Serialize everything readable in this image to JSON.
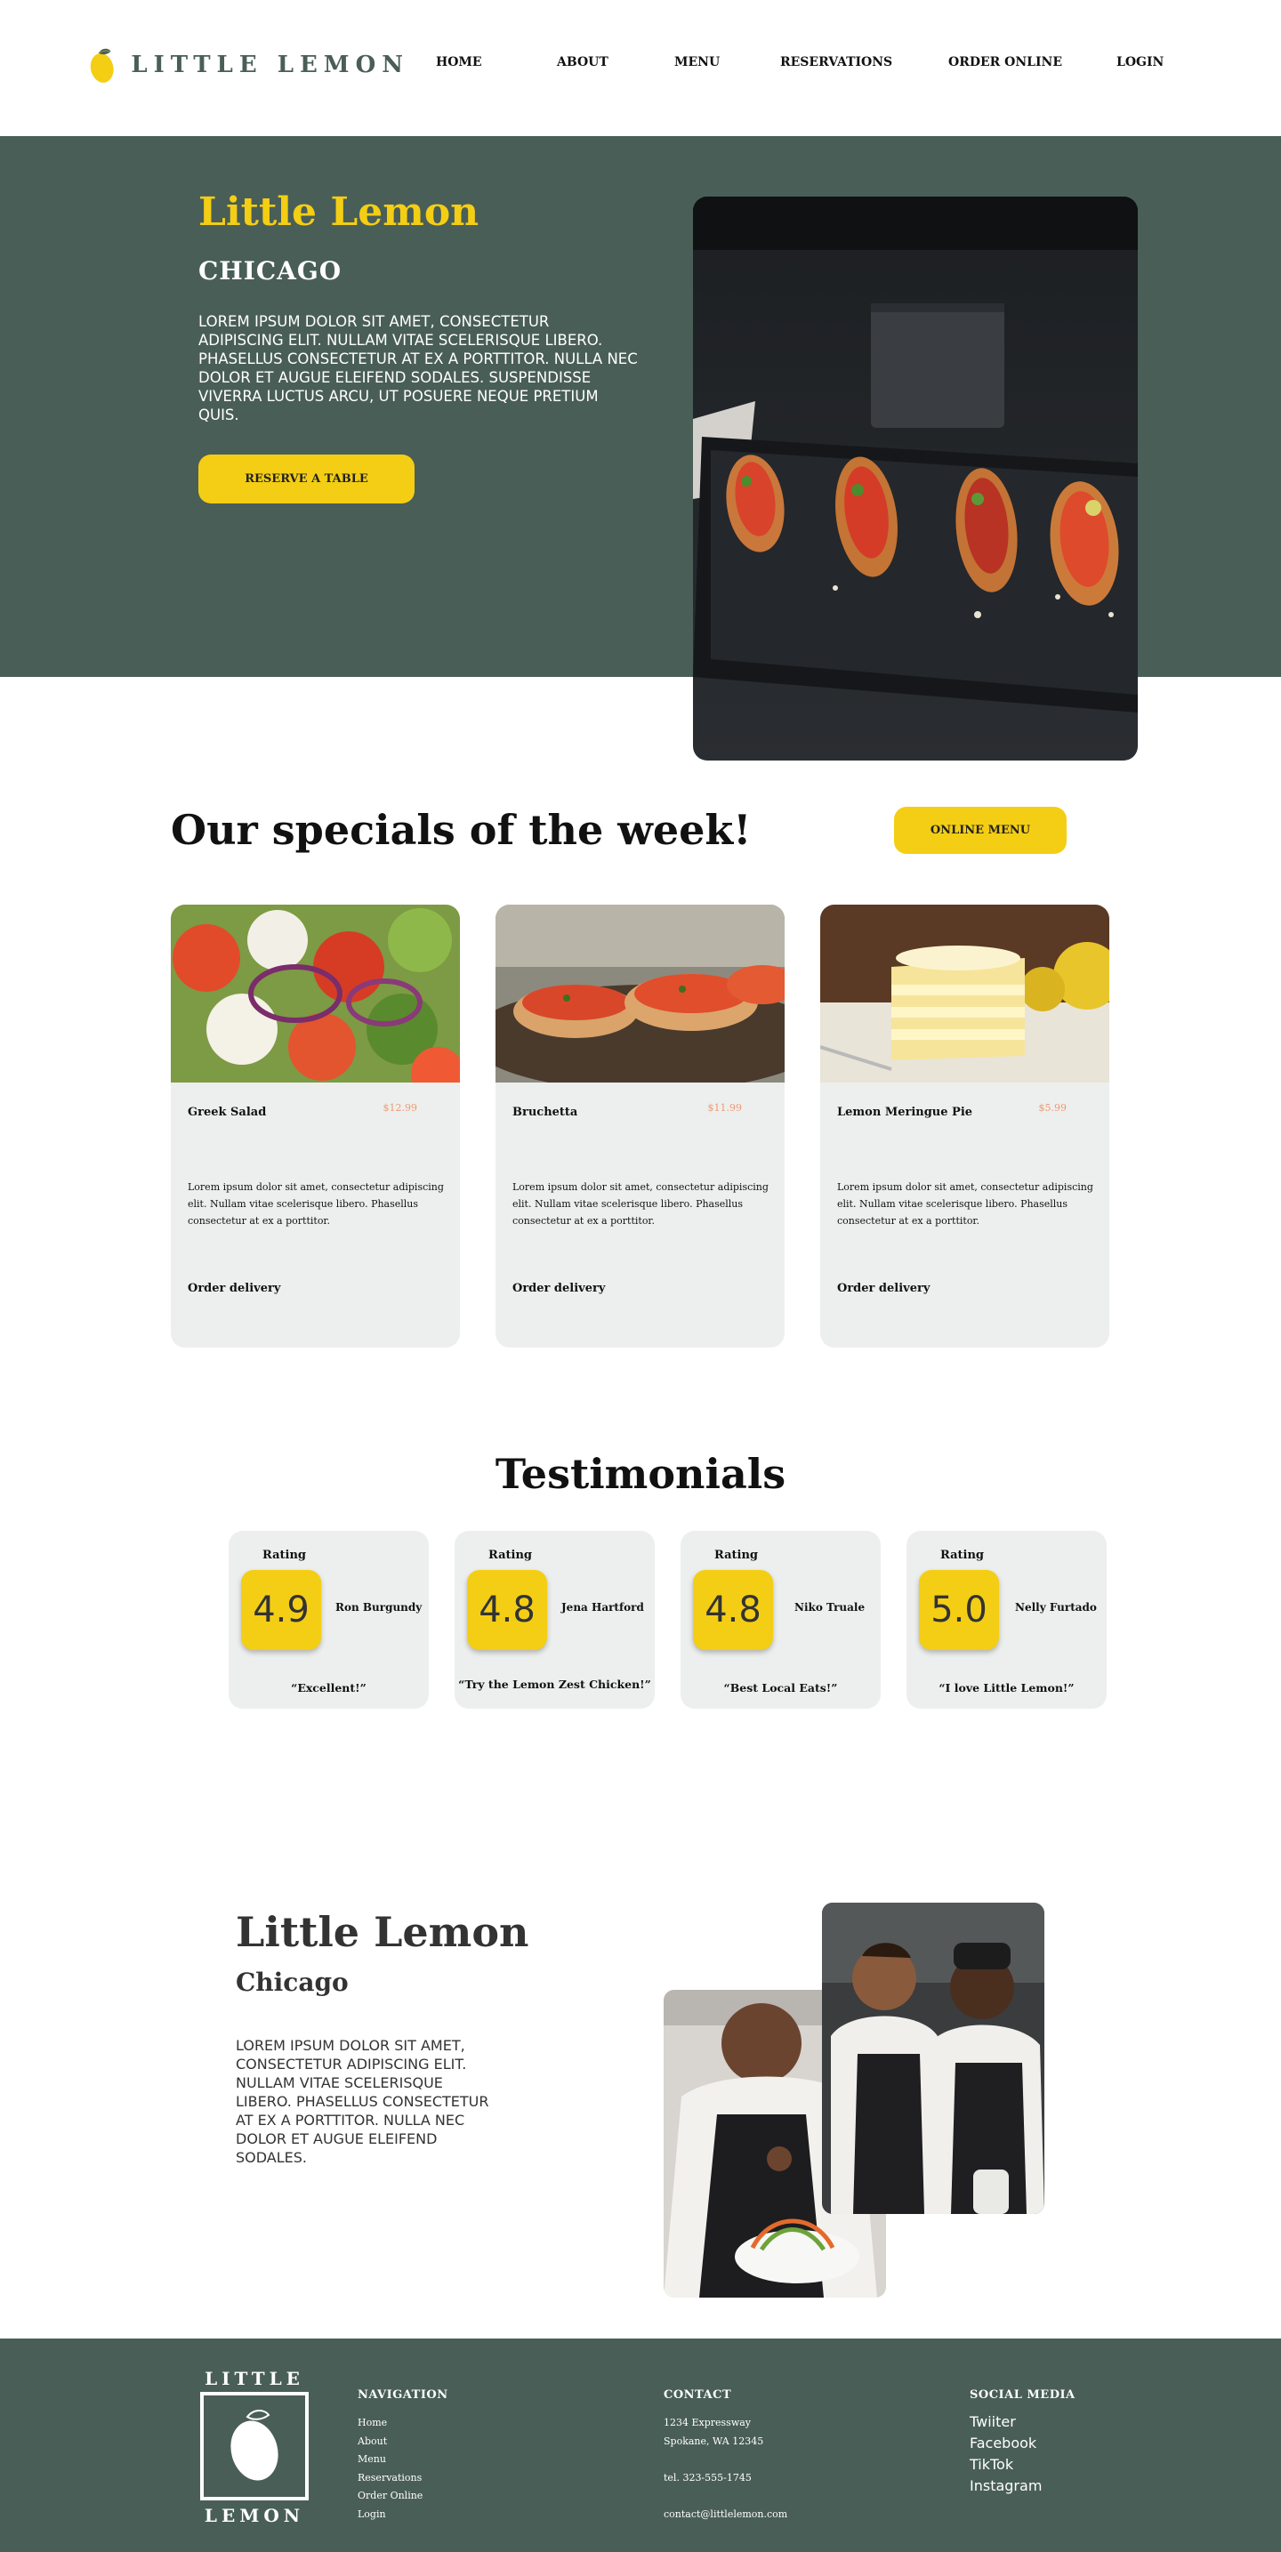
{
  "brand": {
    "name": "LITTLE LEMON",
    "yellow": "#f4ce14",
    "green": "#495e57",
    "card_bg": "#edefee",
    "price_color": "#ee9972"
  },
  "nav": {
    "items": [
      "HOME",
      "ABOUT",
      "MENU",
      "RESERVATIONS",
      "ORDER ONLINE",
      "LOGIN"
    ]
  },
  "hero": {
    "title": "Little Lemon",
    "subtitle": "CHICAGO",
    "text": "Lorem ipsum dolor sit amet, consectetur adipiscing elit. Nullam vitae scelerisque libero. Phasellus consectetur at ex a porttitor. Nulla nec dolor et augue eleifend sodales. Suspendisse viverra luctus arcu, ut posuere neque pretium quis.",
    "button": "RESERVE A TABLE"
  },
  "specials": {
    "title": "Our specials of the week!",
    "menu_button": "ONLINE MENU",
    "cards": [
      {
        "name": "Greek Salad",
        "price": "$12.99",
        "desc": "Lorem ipsum dolor sit amet, consectetur adipiscing elit. Nullam vitae scelerisque libero. Phasellus consectetur at ex a porttitor.",
        "link": "Order delivery"
      },
      {
        "name": "Bruchetta",
        "price": "$11.99",
        "desc": "Lorem ipsum dolor sit amet, consectetur adipiscing elit. Nullam vitae scelerisque libero. Phasellus consectetur at ex a porttitor.",
        "link": "Order delivery"
      },
      {
        "name": "Lemon Meringue Pie",
        "price": "$5.99",
        "desc": "Lorem ipsum dolor sit amet, consectetur adipiscing elit. Nullam vitae scelerisque libero. Phasellus consectetur at ex a porttitor.",
        "link": "Order delivery"
      }
    ]
  },
  "testimonials": {
    "title": "Testimonials",
    "items": [
      {
        "rating_label": "Rating",
        "score": "4.9",
        "name": "Ron Burgundy",
        "quote": "“Excellent!”"
      },
      {
        "rating_label": "Rating",
        "score": "4.8",
        "name": "Jena Hartford",
        "quote": "“Try the Lemon Zest Chicken!”"
      },
      {
        "rating_label": "Rating",
        "score": "4.8",
        "name": "Niko Truale",
        "quote": "“Best Local Eats!”"
      },
      {
        "rating_label": "Rating",
        "score": "5.0",
        "name": "Nelly Furtado",
        "quote": "“I love Little Lemon!”"
      }
    ]
  },
  "about": {
    "title": "Little Lemon",
    "subtitle": "Chicago",
    "text": "Lorem ipsum dolor sit amet, consectetur adipiscing elit. Nullam vitae scelerisque libero. Phasellus consectetur at ex a porttitor. Nulla nec dolor et augue eleifend sodales."
  },
  "footer": {
    "logo_top": "LITTLE",
    "logo_bottom": "LEMON",
    "navigation": {
      "title": "NAVIGATION",
      "links": [
        "Home",
        "About",
        "Menu",
        "Reservations",
        "Order Online",
        "Login"
      ]
    },
    "contact": {
      "title": "CONTACT",
      "address_1": "1234 Expressway",
      "address_2": "Spokane, WA 12345",
      "phone": "tel. 323-555-1745",
      "email": "contact@littlelemon.com"
    },
    "social": {
      "title": "SOCIAL MEDIA",
      "links": [
        "Twiiter",
        "Facebook",
        "TikTok",
        "Instagram"
      ]
    }
  }
}
